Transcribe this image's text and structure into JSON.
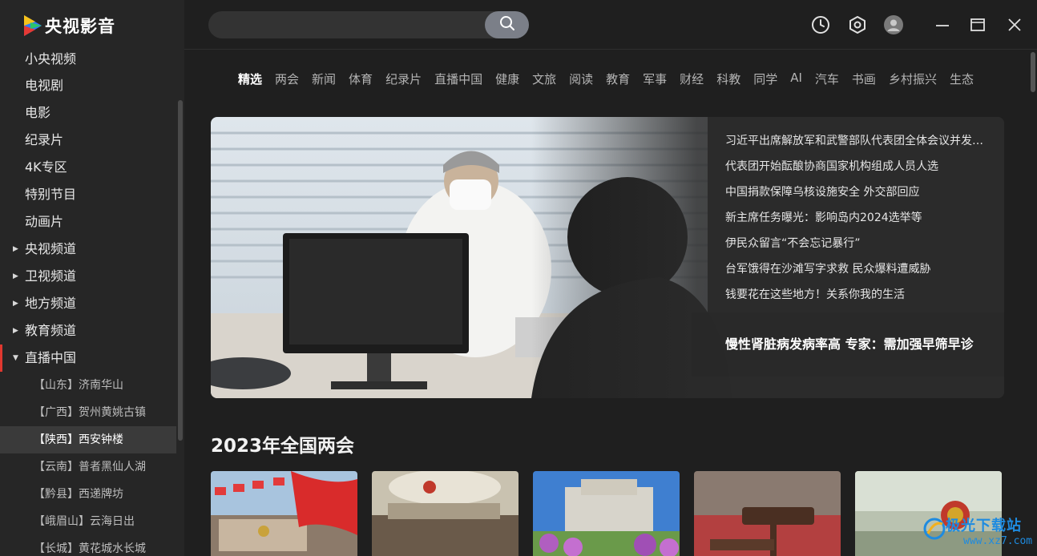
{
  "app": {
    "logo_text": "央视影音"
  },
  "sidebar": {
    "items": [
      {
        "label": "小央视频",
        "caret": ""
      },
      {
        "label": "电视剧",
        "caret": ""
      },
      {
        "label": "电影",
        "caret": ""
      },
      {
        "label": "纪录片",
        "caret": ""
      },
      {
        "label": "4K专区",
        "caret": ""
      },
      {
        "label": "特别节目",
        "caret": ""
      },
      {
        "label": "动画片",
        "caret": ""
      },
      {
        "label": "央视频道",
        "caret": "▶"
      },
      {
        "label": "卫视频道",
        "caret": "▶"
      },
      {
        "label": "地方频道",
        "caret": "▶"
      },
      {
        "label": "教育频道",
        "caret": "▶"
      },
      {
        "label": "直播中国",
        "caret": "▼"
      }
    ],
    "subitems": [
      "【山东】济南华山",
      "【广西】贺州黄姚古镇",
      "【陕西】西安钟楼",
      "【云南】普者黑仙人湖",
      "【黔县】西递牌坊",
      "【峨眉山】云海日出",
      "【长城】黄花城水长城"
    ]
  },
  "search": {
    "value": "",
    "placeholder": ""
  },
  "categories": [
    "精选",
    "两会",
    "新闻",
    "体育",
    "纪录片",
    "直播中国",
    "健康",
    "文旅",
    "阅读",
    "教育",
    "军事",
    "财经",
    "科教",
    "同学",
    "AI",
    "汽车",
    "书画",
    "乡村振兴",
    "生态"
  ],
  "banner": {
    "headlines": [
      "习近平出席解放军和武警部队代表团全体会议并发表重要讲话",
      "代表团开始酝酿协商国家机构组成人员人选",
      "中国捐款保障乌核设施安全 外交部回应",
      "新主席任务曝光：影响岛内2024选举等",
      "伊民众留言“不会忘记暴行”",
      "台军饿得在沙滩写字求救 民众爆料遭威胁",
      "钱要花在这些地方！关系你我的生活"
    ],
    "featured": "慢性肾脏病发病率高 专家：需加强早筛早诊"
  },
  "section": {
    "title": "2023年全国两会"
  },
  "watermark": {
    "text": "极光下载站",
    "sub": "www.xz7.com"
  },
  "colors": {
    "accent": "#e0382f",
    "sidebar_bg": "#262626",
    "main_bg": "#1f1f1f"
  },
  "icons": [
    "search-icon",
    "history-icon",
    "settings-icon",
    "avatar-icon",
    "minimize-icon",
    "maximize-icon",
    "close-icon"
  ]
}
